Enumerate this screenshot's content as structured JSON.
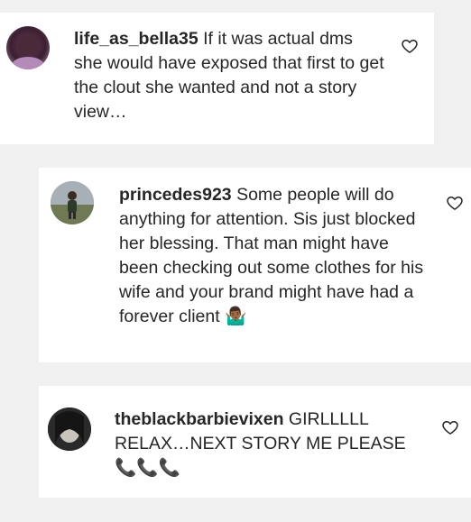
{
  "comments": [
    {
      "username": "life_as_bella35",
      "text": " If it was actual dms she would have exposed that first to get the clout she wanted and not a story view…",
      "avatar_icon": "user-avatar"
    },
    {
      "username": "princedes923",
      "text": " Some people will do anything for attention. Sis just blocked her blessing. That man might have been checking out some clothes for his wife and your brand might have had a forever client ",
      "emoji": "🤷🏾‍♂️",
      "avatar_icon": "user-avatar"
    },
    {
      "username": "theblackbarbievixen",
      "text": " GIRLLLLL RELAX…NEXT STORY ME PLEASE ",
      "emoji": "📞📞📞",
      "avatar_icon": "user-avatar"
    }
  ],
  "icons": {
    "like": "heart-outline-icon"
  },
  "colors": {
    "background": "#f0f0f0",
    "card": "#ffffff",
    "text": "#262626"
  }
}
